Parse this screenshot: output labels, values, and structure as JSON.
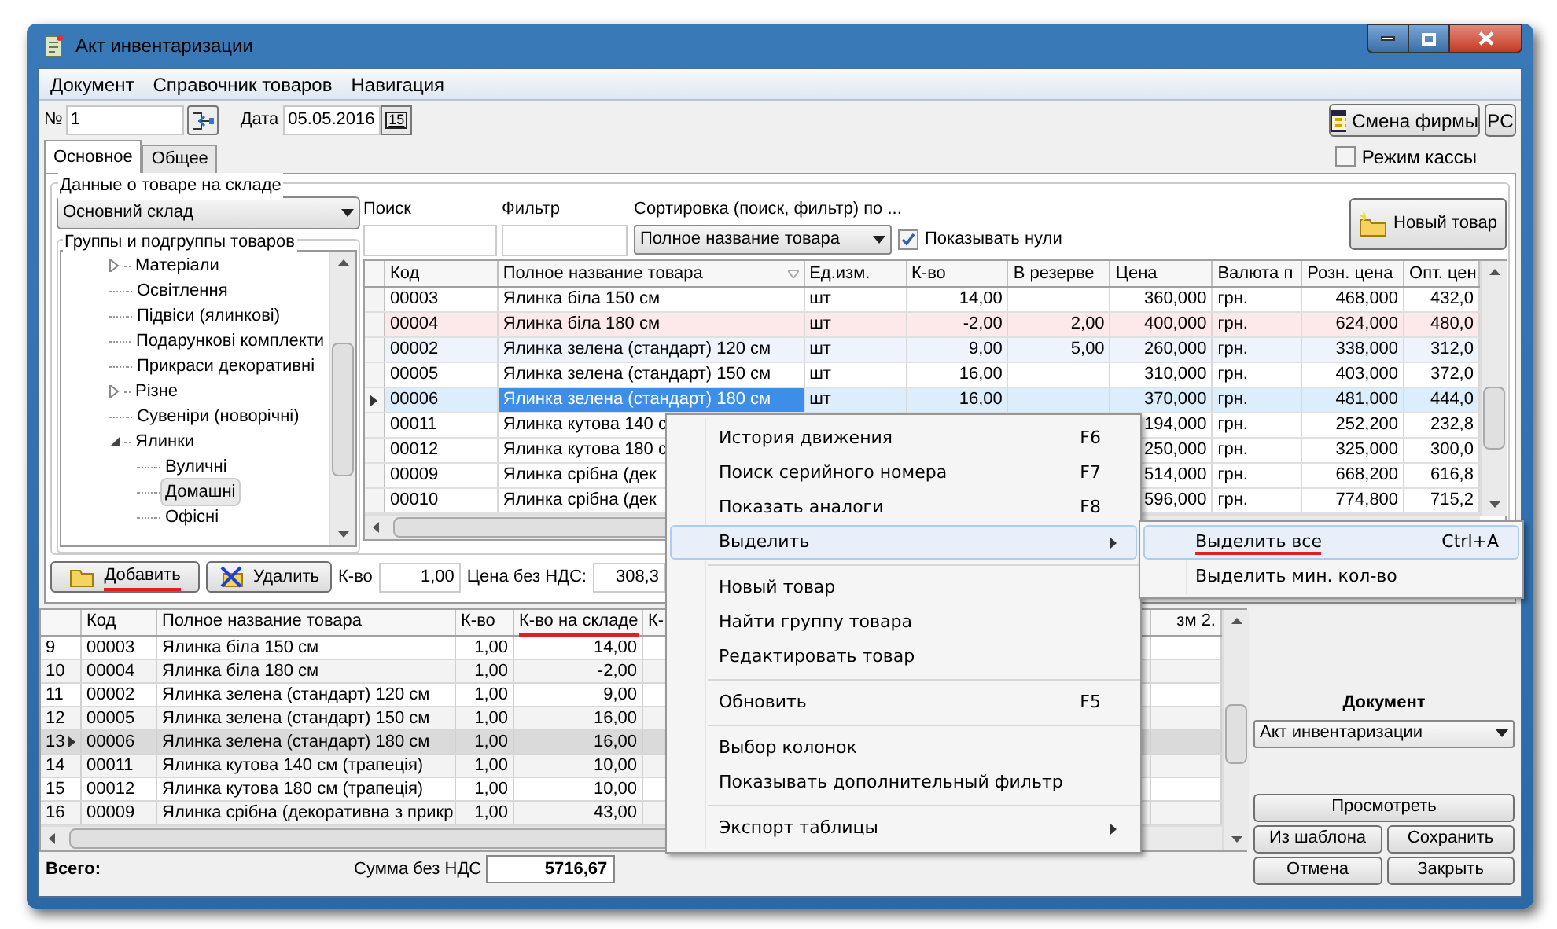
{
  "window": {
    "title": "Акт инвентаризации"
  },
  "menu": [
    "Документ",
    "Справочник товаров",
    "Навигация"
  ],
  "header": {
    "number_label": "№",
    "number": "1",
    "date_label": "Дата",
    "date": "05.05.2016",
    "calendar_button": "15",
    "firm_button": "Смена фирмы",
    "pc_button": "PC",
    "cash_mode": {
      "label": "Режим кассы",
      "checked": false
    }
  },
  "tabs": [
    {
      "label": "Основное",
      "selected": true
    },
    {
      "label": "Общее",
      "selected": false
    }
  ],
  "stock": {
    "title": "Данные о товаре на складе",
    "warehouse": "Основний склад",
    "groups_title": "Группы и подгруппы товаров",
    "tree": [
      {
        "label": "Матеріали",
        "kind": "folder",
        "expanded": false,
        "selected": false
      },
      {
        "label": "Освітлення",
        "kind": "leaf",
        "selected": false
      },
      {
        "label": "Підвіси (ялинкові)",
        "kind": "leaf",
        "selected": false
      },
      {
        "label": "Подарункові комплекти",
        "kind": "leaf",
        "selected": false
      },
      {
        "label": "Прикраси декоративні",
        "kind": "leaf",
        "selected": false
      },
      {
        "label": "Різне",
        "kind": "folder",
        "expanded": false,
        "selected": false
      },
      {
        "label": "Сувеніри (новорічні)",
        "kind": "leaf",
        "selected": false
      },
      {
        "label": "Ялинки",
        "kind": "folder",
        "expanded": true,
        "selected": false,
        "children": [
          {
            "label": "Вуличні",
            "kind": "leaf",
            "selected": false
          },
          {
            "label": "Домашні",
            "kind": "leaf",
            "selected": true
          },
          {
            "label": "Офісні",
            "kind": "leaf",
            "selected": false
          }
        ]
      }
    ]
  },
  "search": {
    "label": "Поиск"
  },
  "filter": {
    "label": "Фильтр"
  },
  "sort": {
    "label": "Сортировка (поиск, фильтр) по ...",
    "value": "Полное название товара"
  },
  "show_zeros": {
    "label": "Показывать нули",
    "checked": true
  },
  "new_item_button": "Новый товар",
  "goods_table": {
    "columns": [
      "Код",
      "Полное название товара",
      "Ед.изм.",
      "К-во",
      "В резерве",
      "Цена",
      "Валюта п",
      "Розн. цена",
      "Опт. цен"
    ],
    "rows": [
      {
        "kind": "normal",
        "selected": false,
        "cells": [
          "00003",
          "Ялинка біла 150 см",
          "шт",
          "14,00",
          null,
          "360,000",
          "грн.",
          "468,000",
          "432,0"
        ]
      },
      {
        "kind": "negative",
        "selected": false,
        "cells": [
          "00004",
          "Ялинка біла 180 см",
          "шт",
          "-2,00",
          "2,00",
          "400,000",
          "грн.",
          "624,000",
          "480,0"
        ]
      },
      {
        "kind": "reserved",
        "selected": false,
        "cells": [
          "00002",
          "Ялинка зелена (стандарт) 120 см",
          "шт",
          "9,00",
          "5,00",
          "260,000",
          "грн.",
          "338,000",
          "312,0"
        ]
      },
      {
        "kind": "normal",
        "selected": false,
        "cells": [
          "00005",
          "Ялинка зелена (стандарт) 150 см",
          "шт",
          "16,00",
          null,
          "310,000",
          "грн.",
          "403,000",
          "372,0"
        ]
      },
      {
        "kind": "normal",
        "selected": true,
        "cells": [
          "00006",
          "Ялинка зелена (стандарт) 180 см",
          "шт",
          "16,00",
          null,
          "370,000",
          "грн.",
          "481,000",
          "444,0"
        ]
      },
      {
        "kind": "normal",
        "selected": false,
        "cells": [
          "00011",
          "Ялинка кутова 140 с",
          null,
          null,
          null,
          "194,000",
          "грн.",
          "252,200",
          "232,8"
        ]
      },
      {
        "kind": "normal",
        "selected": false,
        "cells": [
          "00012",
          "Ялинка кутова 180 с",
          null,
          null,
          null,
          "250,000",
          "грн.",
          "325,000",
          "300,0"
        ]
      },
      {
        "kind": "normal",
        "selected": false,
        "cells": [
          "00009",
          "Ялинка срібна (дек",
          null,
          null,
          null,
          "514,000",
          "грн.",
          "668,200",
          "616,8"
        ]
      },
      {
        "kind": "normal",
        "selected": false,
        "cells": [
          "00010",
          "Ялинка срібна (дек",
          null,
          null,
          null,
          "596,000",
          "грн.",
          "774,800",
          "715,2"
        ]
      }
    ]
  },
  "actions": {
    "buttons": [
      {
        "label": "Добавить",
        "kind": "add",
        "marked": true
      },
      {
        "label": "Удалить",
        "kind": "delete",
        "marked": false
      }
    ],
    "qty_label": "К-во",
    "qty": "1,00",
    "price_label": "Цена без НДС:",
    "price": "308,3"
  },
  "doc_table": {
    "columns": [
      {
        "label": "Код",
        "marked": false
      },
      {
        "label": "Полное название товара",
        "marked": false
      },
      {
        "label": "К-во",
        "marked": false
      },
      {
        "label": "К-во на складе",
        "marked": true
      },
      {
        "label": "К-",
        "marked": false
      },
      {
        "label": "зм 2.",
        "marked": false
      }
    ],
    "rows": [
      {
        "number": "9",
        "selected": false,
        "cells": [
          "00003",
          "Ялинка біла 150 см",
          "1,00",
          "14,00"
        ]
      },
      {
        "number": "10",
        "selected": false,
        "cells": [
          "00004",
          "Ялинка біла 180 см",
          "1,00",
          "-2,00"
        ]
      },
      {
        "number": "11",
        "selected": false,
        "cells": [
          "00002",
          "Ялинка зелена (стандарт) 120 см",
          "1,00",
          "9,00"
        ]
      },
      {
        "number": "12",
        "selected": false,
        "cells": [
          "00005",
          "Ялинка зелена (стандарт) 150 см",
          "1,00",
          "16,00"
        ]
      },
      {
        "number": "13",
        "selected": true,
        "cells": [
          "00006",
          "Ялинка зелена (стандарт) 180 см",
          "1,00",
          "16,00"
        ]
      },
      {
        "number": "14",
        "selected": false,
        "cells": [
          "00011",
          "Ялинка кутова 140 см (трапеція)",
          "1,00",
          "10,00"
        ]
      },
      {
        "number": "15",
        "selected": false,
        "cells": [
          "00012",
          "Ялинка кутова 180 см (трапеція)",
          "1,00",
          "10,00"
        ]
      },
      {
        "number": "16",
        "selected": false,
        "cells": [
          "00009",
          "Ялинка срібна (декоративна з прикр",
          "1,00",
          "43,00"
        ]
      }
    ]
  },
  "document": {
    "label": "Документ",
    "type": "Акт инвентаризации",
    "buttons": [
      "Просмотреть",
      "Из шаблона",
      "Сохранить",
      "Отмена",
      "Закрыть"
    ]
  },
  "totals": {
    "label": "Всего:",
    "sum_label": "Сумма без НДС",
    "sum": "5716,67"
  },
  "context_menu": {
    "items": [
      {
        "kind": "item",
        "label": "История движения",
        "shortcut": "F6",
        "selected": false
      },
      {
        "kind": "item",
        "label": "Поиск серийного номера",
        "shortcut": "F7",
        "selected": false
      },
      {
        "kind": "item",
        "label": "Показать аналоги",
        "shortcut": "F8",
        "selected": false
      },
      {
        "kind": "submenu",
        "label": "Выделить",
        "selected": true
      },
      {
        "kind": "separator"
      },
      {
        "kind": "item",
        "label": "Новый товар",
        "selected": false
      },
      {
        "kind": "item",
        "label": "Найти группу товара",
        "selected": false
      },
      {
        "kind": "item",
        "label": "Редактировать товар",
        "selected": false
      },
      {
        "kind": "separator"
      },
      {
        "kind": "item",
        "label": "Обновить",
        "shortcut": "F5",
        "selected": false
      },
      {
        "kind": "separator"
      },
      {
        "kind": "item",
        "label": "Выбор колонок",
        "selected": false
      },
      {
        "kind": "item",
        "label": "Показывать дополнительный фильтр",
        "selected": false
      },
      {
        "kind": "separator"
      },
      {
        "kind": "submenu",
        "label": "Экспорт таблицы",
        "selected": false
      }
    ]
  },
  "submenu": {
    "items": [
      {
        "label": "Выделить все",
        "shortcut": "Ctrl+A",
        "selected": true,
        "marked": true
      },
      {
        "label": "Выделить мин. кол-во",
        "selected": false,
        "marked": false
      }
    ]
  }
}
